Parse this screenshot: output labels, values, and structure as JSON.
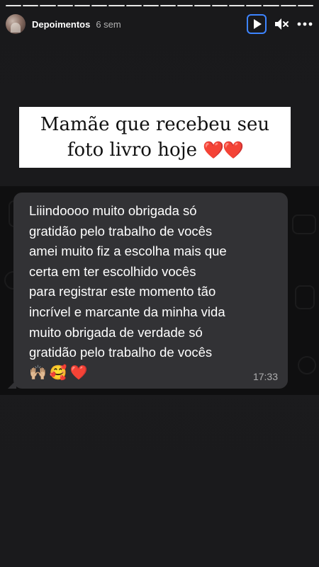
{
  "story": {
    "username": "Depoimentos",
    "time_ago": "6 sem",
    "progress_segments": 18,
    "active_segment": 18
  },
  "controls": {
    "play_icon": "play-icon",
    "mute_icon": "speaker-muted-icon",
    "more_icon": "more-horizontal-icon",
    "accent_color": "#3d84ff"
  },
  "caption": {
    "line1": "Mamãe que recebeu seu",
    "line2": "foto livro hoje",
    "hearts": "❤️❤️"
  },
  "message": {
    "lines": [
      "Liiindoooo muito obrigada só",
      "gratidão pelo trabalho de vocês",
      "amei muito fiz a escolha mais que",
      "certa em ter escolhido vocês",
      "para registrar este momento tão",
      "incrível e marcante da minha vida",
      "muito obrigada de verdade só",
      "gratidão pelo trabalho de vocês"
    ],
    "emojis": [
      "🙌🏼",
      "🥰",
      "❤️"
    ],
    "timestamp": "17:33"
  }
}
